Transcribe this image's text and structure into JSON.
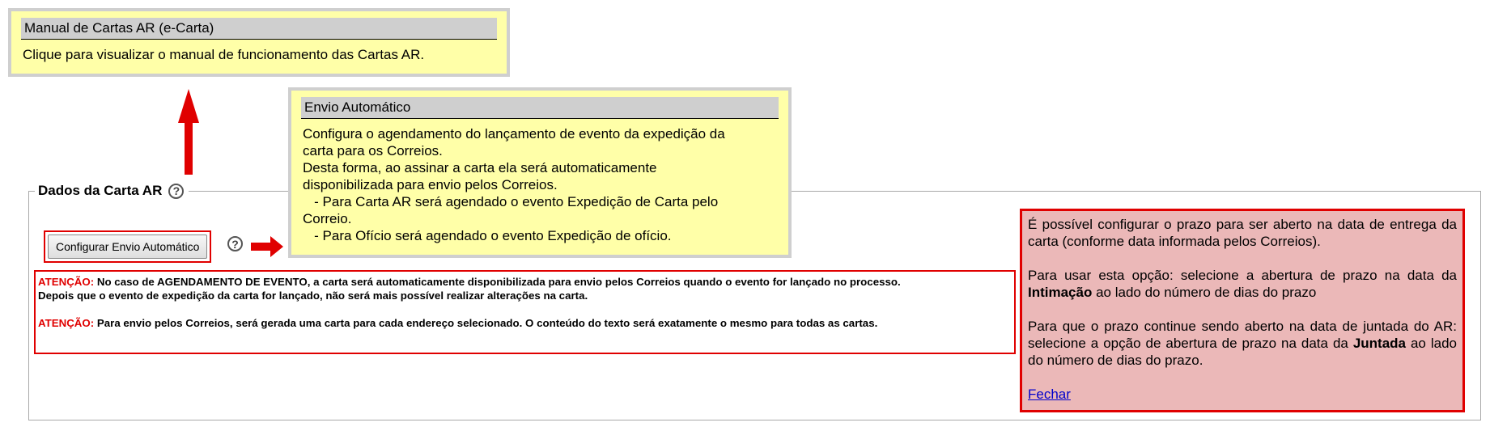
{
  "tooltip_manual": {
    "title": "Manual de Cartas AR (e-Carta)",
    "body": "Clique para visualizar o manual de funcionamento das Cartas AR."
  },
  "tooltip_envio": {
    "title": "Envio Automático",
    "lines": [
      "Configura o agendamento do lançamento de evento da expedição da",
      "carta para os Correios.",
      "Desta forma, ao assinar a carta ela será automaticamente",
      "disponibilizada para envio pelos Correios.",
      "   - Para Carta AR será agendado o evento Expedição de Carta pelo",
      "Correio.",
      "   - Para Ofício será agendado o evento Expedição de ofício."
    ]
  },
  "fieldset": {
    "legend": "Dados da Carta AR",
    "help_glyph": "?"
  },
  "config_button": {
    "label": "Configurar Envio Automático"
  },
  "attention": {
    "label1": "ATENÇÃO:",
    "text1a": " No caso de AGENDAMENTO DE EVENTO, a carta será automaticamente disponibilizada para envio pelos Correios quando o evento for lançado no processo.",
    "text1b": "Depois que o evento de expedição da carta for lançado, não será mais possível realizar alterações na carta.",
    "label2": "ATENÇÃO:",
    "text2": " Para envio pelos Correios, será gerada uma carta para cada endereço selecionado. O conteúdo do texto será exatamente o mesmo para todas as cartas."
  },
  "info_box": {
    "p1": "É possível configurar o prazo para ser aberto na data de entrega da carta (conforme data informada pelos Correios).",
    "p2_pre": "Para usar esta opção: selecione a abertura de prazo na data da ",
    "p2_bold": "Intimação",
    "p2_post": " ao lado do número de dias do prazo",
    "p3_pre": "Para que o prazo continue sendo aberto na data de juntada do AR: selecione a opção de abertura de prazo na data da ",
    "p3_bold": "Juntada",
    "p3_post": " ao lado do número de dias do prazo.",
    "close_link": "Fechar"
  },
  "colors": {
    "tooltip_bg": "#ffffa8",
    "highlight_red": "#e00000",
    "info_bg": "#ebb8b8"
  }
}
